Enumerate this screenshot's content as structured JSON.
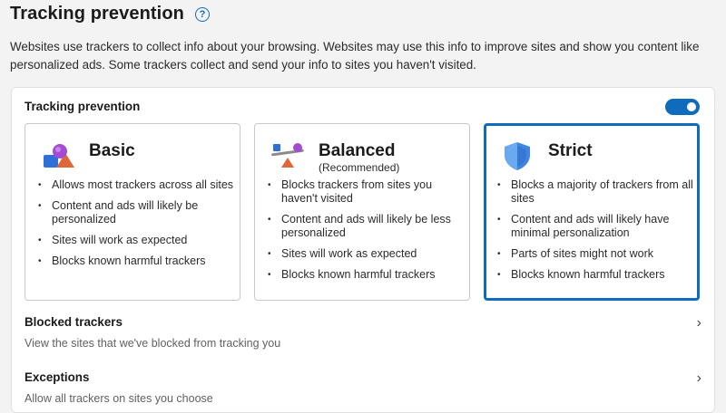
{
  "header": {
    "title": "Tracking prevention",
    "help_glyph": "?"
  },
  "description": "Websites use trackers to collect info about your browsing. Websites may use this info to improve sites and show you content like personalized ads. Some trackers collect and send your info to sites you haven't visited.",
  "panel": {
    "label": "Tracking prevention",
    "toggle_on": true
  },
  "cards": [
    {
      "title": "Basic",
      "subtitle": "",
      "icon": "shapes-icon",
      "selected": false,
      "bullets": [
        "Allows most trackers across all sites",
        "Content and ads will likely be personalized",
        "Sites will work as expected",
        "Blocks known harmful trackers"
      ]
    },
    {
      "title": "Balanced",
      "subtitle": "(Recommended)",
      "icon": "balance-icon",
      "selected": false,
      "bullets": [
        "Blocks trackers from sites you haven't visited",
        "Content and ads will likely be less personalized",
        "Sites will work as expected",
        "Blocks known harmful trackers"
      ]
    },
    {
      "title": "Strict",
      "subtitle": "",
      "icon": "shield-icon",
      "selected": true,
      "bullets": [
        "Blocks a majority of trackers from all sites",
        "Content and ads will likely have minimal personalization",
        "Parts of sites might not work",
        "Blocks known harmful trackers"
      ]
    }
  ],
  "blocked_trackers": {
    "title": "Blocked trackers",
    "description": "View the sites that we've blocked from tracking you"
  },
  "exceptions": {
    "title": "Exceptions",
    "description": "Allow all trackers on sites you choose"
  },
  "colors": {
    "accent": "#0f6cbd",
    "background": "#f3f3f3"
  }
}
